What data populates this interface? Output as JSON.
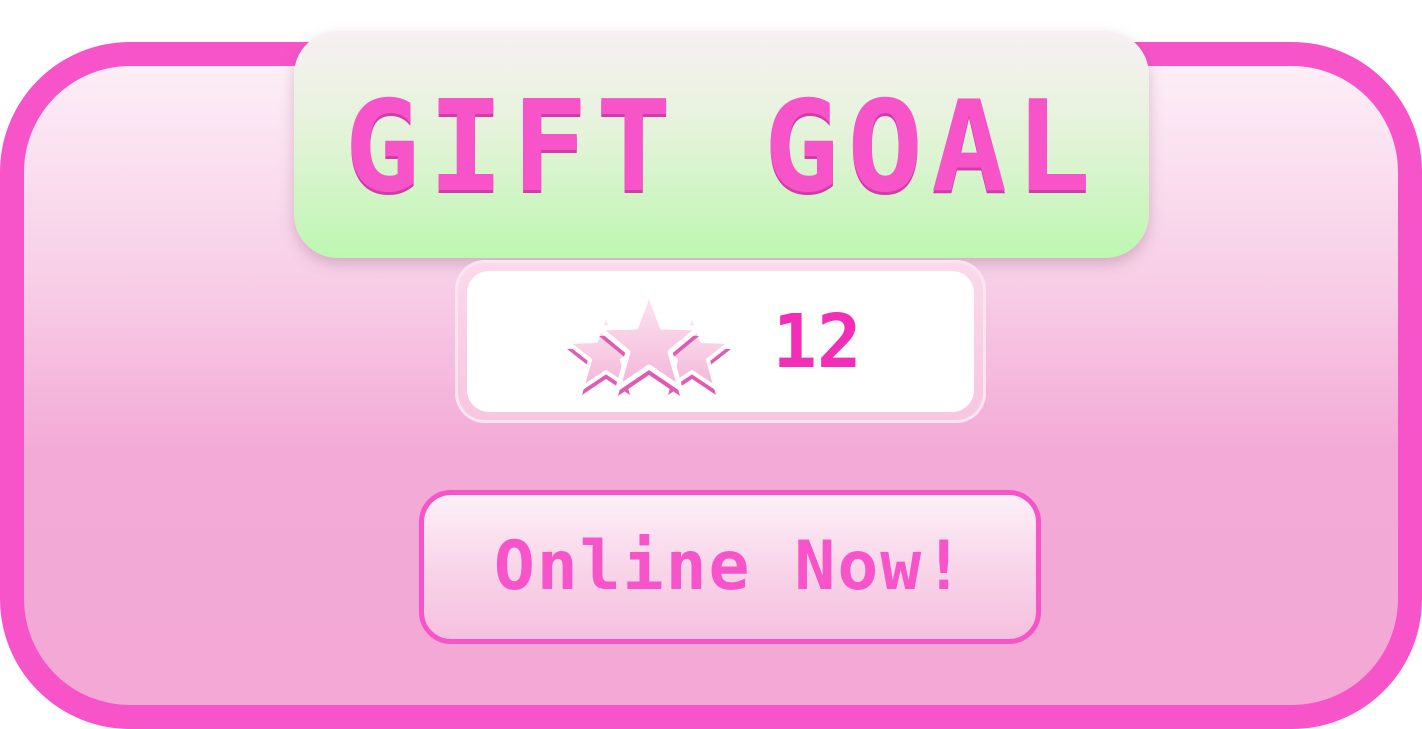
{
  "widget": {
    "title": "GIFT GOAL",
    "count": "12",
    "count_icon": "stars-icon",
    "status_label": "Online Now!"
  },
  "colors": {
    "border": "#f754c9",
    "title_text": "#f754c9",
    "count_text": "#f22eb8",
    "panel_green": "#bdf7b1",
    "background_pink": "#f3aad6"
  }
}
